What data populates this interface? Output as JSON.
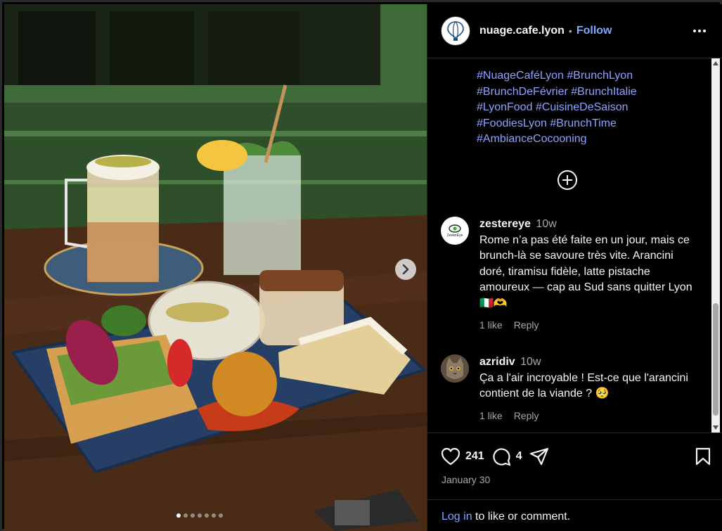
{
  "post": {
    "username": "nuage.cafe.lyon",
    "separator": "•",
    "follow_label": "Follow",
    "date": "January 30",
    "likes": "241",
    "comments_count": "4",
    "carousel": {
      "slides": 7,
      "active": 0
    }
  },
  "caption": {
    "hashtags": [
      "#NuageCaféLyon",
      "#BrunchLyon",
      "#BrunchDeFévrier",
      "#BrunchItalie",
      "#LyonFood",
      "#CuisineDeSaison",
      "#FoodiesLyon",
      "#BrunchTime",
      "#AmbianceCocooning"
    ]
  },
  "comments": [
    {
      "user": "zestereye",
      "time": "10w",
      "text": "Rome n’a pas été faite en un jour, mais ce brunch-là se savoure très vite. Arancini doré, tiramisu fidèle, latte pistache amoureux — cap au Sud sans quitter Lyon 🇮🇹🫶",
      "likes": "1 like",
      "reply": "Reply",
      "avatar_label": "ZesterEye"
    },
    {
      "user": "azridiv",
      "time": "10w",
      "text": "Ça a l'air incroyable ! Est-ce que l'arancini contient de la viande ? 🥺",
      "likes": "1 like",
      "reply": "Reply"
    }
  ],
  "footer": {
    "login_link": "Log in",
    "login_rest": " to like or comment."
  },
  "colors": {
    "link": "#8ea2ff",
    "follow": "#7fa8ff",
    "background": "#000000"
  }
}
